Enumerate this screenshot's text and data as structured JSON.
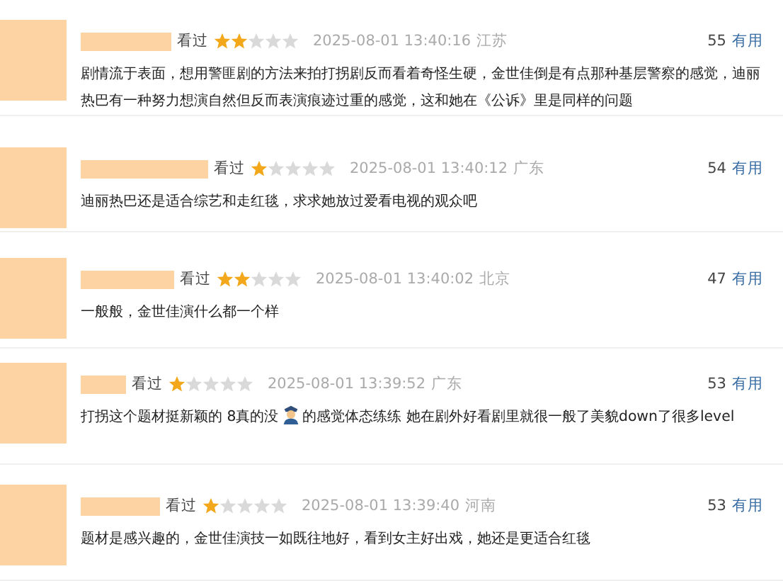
{
  "comments": [
    {
      "status": "看过",
      "stars": 2,
      "time": "2025-08-01 13:40:16",
      "location": "江苏",
      "votes": "55",
      "votes_label": "有用",
      "text": [
        "剧情流于表面，想用警匪剧的方法来拍打拐剧反而看着奇怪生硬，金世佳倒是有点那种基层警察的感觉，迪丽热巴有一种努力想演自然但反而表演痕迹过重的感觉，这和她在《公诉》里是同样的问题"
      ]
    },
    {
      "status": "看过",
      "stars": 1,
      "time": "2025-08-01 13:40:12",
      "location": "广东",
      "votes": "54",
      "votes_label": "有用",
      "text": [
        "迪丽热巴还是适合综艺和走红毯，求求她放过爱看电视的观众吧"
      ]
    },
    {
      "status": "看过",
      "stars": 2,
      "time": "2025-08-01 13:40:02",
      "location": "北京",
      "votes": "47",
      "votes_label": "有用",
      "text": [
        "一般般，金世佳演什么都一个样"
      ]
    },
    {
      "status": "看过",
      "stars": 1,
      "time": "2025-08-01 13:39:52",
      "location": "广东",
      "votes": "53",
      "votes_label": "有用",
      "text": [
        "打拐这个题材挺新颖的 8真的没",
        "的感觉体态练练 她在剧外好看剧里就很一般了美貌down了很多level"
      ]
    },
    {
      "status": "看过",
      "stars": 1,
      "time": "2025-08-01 13:39:40",
      "location": "河南",
      "votes": "53",
      "votes_label": "有用",
      "text": [
        "题材是感兴趣的，金世佳演技一如既往地好，看到女主好出戏，她还是更适合红毯"
      ]
    }
  ]
}
